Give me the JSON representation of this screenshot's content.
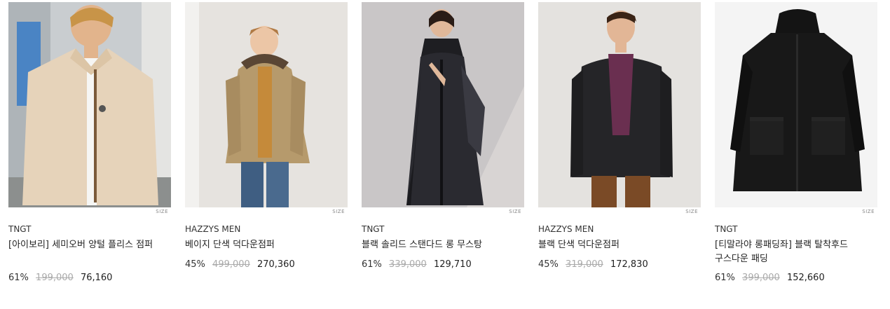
{
  "products": [
    {
      "brand": "TNGT",
      "name": "[아이보리] 세미오버 양털 플리스 점퍼",
      "discount": "61%",
      "original_price": "199,000",
      "price": "76,160",
      "size_tag": "SIZE",
      "image_desc": "model wearing ivory fleece jacket"
    },
    {
      "brand": "HAZZYS MEN",
      "name": "베이지 단색 덕다운점퍼",
      "discount": "45%",
      "original_price": "499,000",
      "price": "270,360",
      "size_tag": "SIZE",
      "image_desc": "model wearing beige hooded down jacket"
    },
    {
      "brand": "TNGT",
      "name": "블랙 솔리드 스탠다드 롱 무스탕",
      "discount": "61%",
      "original_price": "339,000",
      "price": "129,710",
      "size_tag": "SIZE",
      "image_desc": "model wearing black long shearling coat"
    },
    {
      "brand": "HAZZYS MEN",
      "name": "블랙 단색 덕다운점퍼",
      "discount": "45%",
      "original_price": "319,000",
      "price": "172,830",
      "size_tag": "SIZE",
      "image_desc": "model wearing black quilted down jacket"
    },
    {
      "brand": "TNGT",
      "name": "[티말라야 롱패딩좌] 블랙 탈착후드 구스다운 패딩",
      "discount": "61%",
      "original_price": "399,000",
      "price": "152,660",
      "size_tag": "SIZE",
      "image_desc": "black hooded long goose down parka"
    }
  ]
}
